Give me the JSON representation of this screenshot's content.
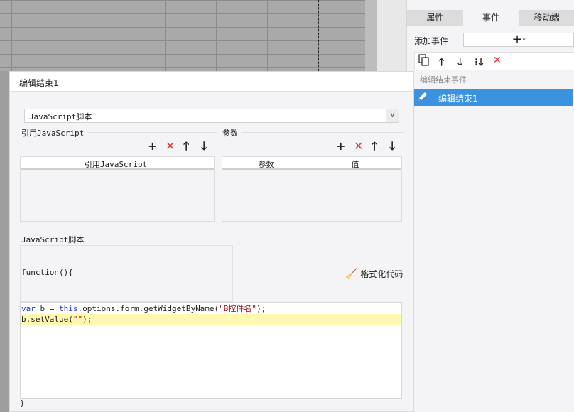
{
  "right_panel": {
    "tabs": [
      "属性",
      "事件",
      "移动端"
    ],
    "active_tab": 1,
    "add_event_label": "添加事件",
    "add_event_button": "+",
    "event_group_label": "编辑结束事件",
    "event_item_label": "编辑结束1"
  },
  "dialog": {
    "title": "编辑结束1",
    "type_select_value": "JavaScript脚本",
    "ref_js_section": "引用JavaScript",
    "params_section": "参数",
    "ref_js_column": "引用JavaScript",
    "param_columns": [
      "参数",
      "值"
    ],
    "script_section": "JavaScript脚本",
    "format_button": "格式化代码",
    "code_header": "function(){",
    "code_footer": "}",
    "code": {
      "line1_kw1": "var",
      "line1_mid1": " b = ",
      "line1_kw2": "this",
      "line1_mid2": ".options.form.getWidgetByName(",
      "line1_str": "\"B控件名\"",
      "line1_end": ");",
      "line2_start": "b.setValue(",
      "line2_str": "\"\"",
      "line2_end": ");"
    }
  },
  "colors": {
    "accent": "#3b93df",
    "delete_red": "#e53935",
    "keyword_blue": "#1f3bd6",
    "string_red": "#a31515",
    "highlight_line": "#fff8b0"
  }
}
